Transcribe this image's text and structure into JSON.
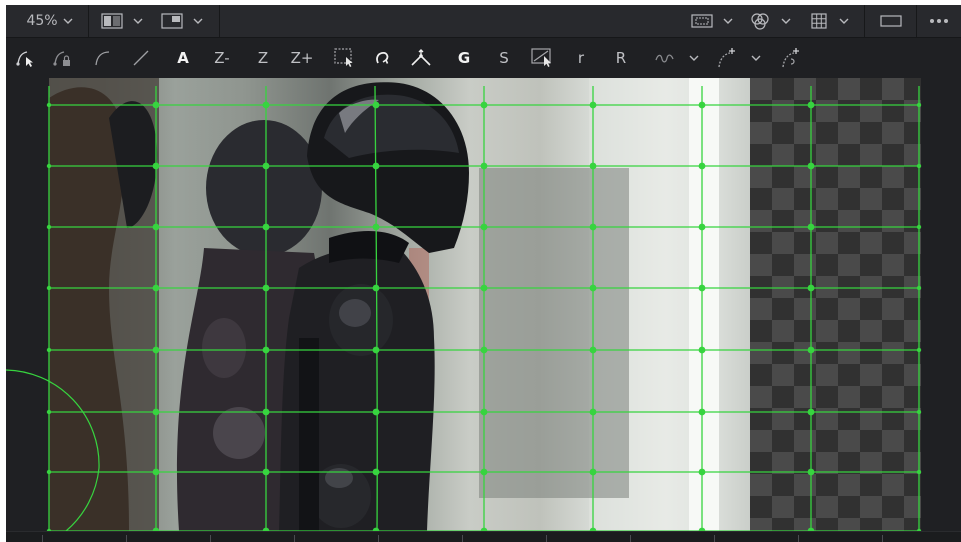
{
  "toolbar": {
    "zoom_label": "45%"
  },
  "tools": {
    "text_a": "A",
    "text_zminus": "Z-",
    "text_z": "Z",
    "text_zplus": "Z+",
    "text_g": "G",
    "text_s": "S",
    "text_r_lower": "r",
    "text_r_upper": "R"
  },
  "icons": {
    "viewer_layout": "split-view-icon",
    "viewer_wipe": "wipe-view-icon",
    "roi": "roi-icon",
    "channels": "color-channels-icon",
    "grid": "grid-icon",
    "aspect": "aspect-rectangle-icon",
    "more": "more-options-icon"
  },
  "colors": {
    "grid_line": "#37d43f",
    "background": "#1e1f22",
    "toolbar": "#28292d"
  }
}
